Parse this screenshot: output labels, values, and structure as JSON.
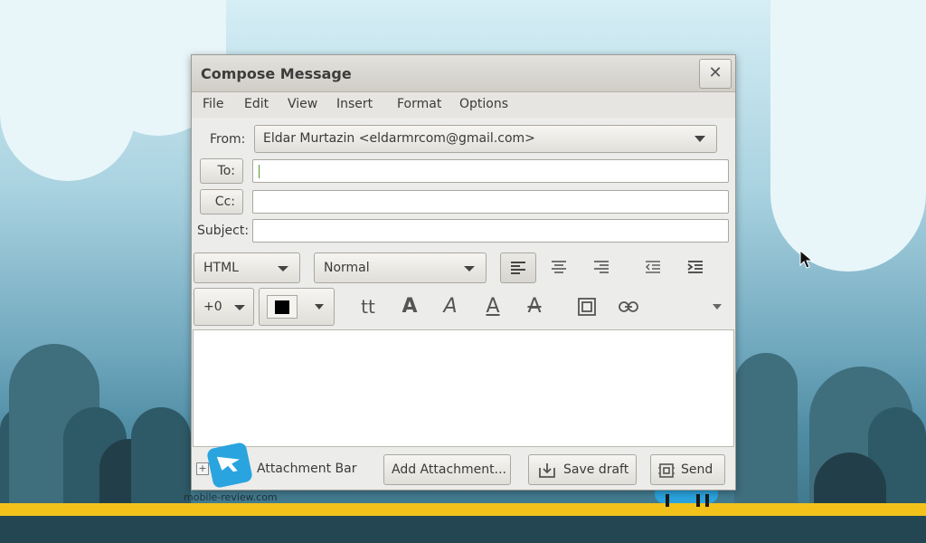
{
  "window": {
    "title": "Compose Message"
  },
  "menu": {
    "items": [
      "File",
      "Edit",
      "View",
      "Insert",
      "Format",
      "Options"
    ]
  },
  "fields": {
    "from_label": "From:",
    "from_value": "Eldar Murtazin <eldarmrcom@gmail.com>",
    "to_label": "To:",
    "to_value": "",
    "cc_label": "Cc:",
    "cc_value": "",
    "subject_label": "Subject:",
    "subject_value": ""
  },
  "toolbar": {
    "mode": "HTML",
    "paragraph_style": "Normal",
    "font_size": "+0",
    "text_color": "#000000",
    "teletype_glyph": "tt",
    "bold_glyph": "A",
    "italic_glyph": "A",
    "underline_glyph": "A",
    "strike_glyph": "A"
  },
  "attachments": {
    "bar_label": "Attachment Bar",
    "expander": "+"
  },
  "actions": {
    "add_attachment": "Add Attachment...",
    "save_draft": "Save draft",
    "send": "Send"
  },
  "background": {
    "watermark": "mobile-review.com"
  },
  "colors": {
    "accent_yellow": "#f2c21b",
    "logo_blue": "#2aa4df"
  }
}
